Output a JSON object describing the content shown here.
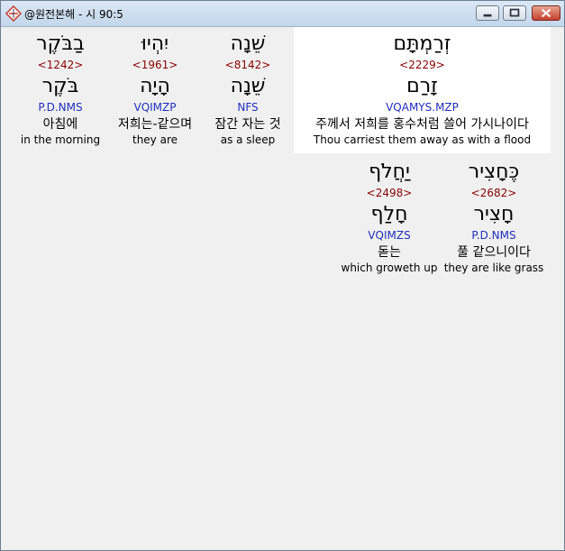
{
  "window": {
    "title": "@원전본해 - 시 90:5"
  },
  "words": [
    {
      "hebrew": "בַבֹּקֶר",
      "strong": "<1242>",
      "lemma": "בֹּקֶר",
      "parse": "P.D.NMS",
      "korean": "아침에",
      "english": "in the morning"
    },
    {
      "hebrew": "יִהְיוּ",
      "strong": "<1961>",
      "lemma": "הָיָה",
      "parse": "VQIMZP",
      "korean": "저희는-같으며",
      "english": "they are"
    },
    {
      "hebrew": "שֵׁנָה",
      "strong": "<8142>",
      "lemma": "שֵׁנָה",
      "parse": "NFS",
      "korean": "잠간 자는 것",
      "english": "as a sleep"
    },
    {
      "hebrew": "זְרַמְתָּם",
      "strong": "<2229>",
      "lemma": "זָרַם",
      "parse": "VQAMYS.MZP",
      "korean": "주께서 저희를 홍수처럼 쓸어 가시나이다",
      "english": "Thou carriest them away as with a flood"
    },
    {
      "hebrew": "כֶּחָצִיר",
      "strong": "<2682>",
      "lemma": "חָצִיר",
      "parse": "P.D.NMS",
      "korean": "풀 같으니이다",
      "english": "they are like grass"
    },
    {
      "hebrew": "יַחֲלֹף",
      "strong": "<2498>",
      "lemma": "חָלַף",
      "parse": "VQIMZS",
      "korean": "돋는",
      "english": "which groweth up"
    }
  ]
}
